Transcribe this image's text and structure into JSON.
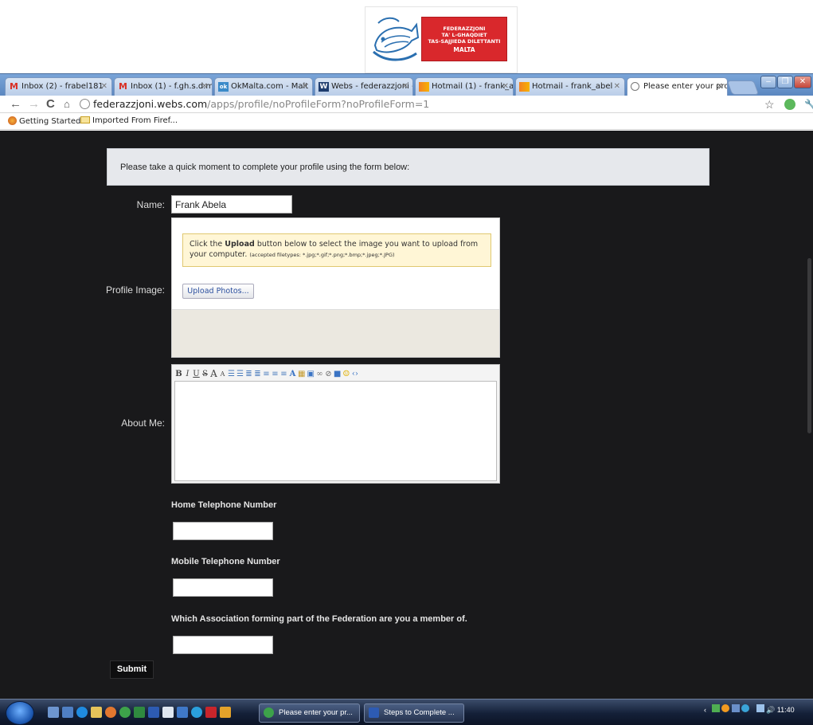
{
  "logo": {
    "lines": [
      "FEDERAZZJONI",
      "TA' L-GHAQDIET",
      "TAS-SAJJIEDA DILETTANTI",
      "MALTA"
    ]
  },
  "browser": {
    "tabs": [
      {
        "label": "Inbox (2) - frabel181",
        "icon": "gmail-icon"
      },
      {
        "label": "Inbox (1) - f.gh.s.d.m",
        "icon": "gmail-icon"
      },
      {
        "label": "OkMalta.com - Malt",
        "icon": "okmalta-icon"
      },
      {
        "label": "Webs - federazzjoni -",
        "icon": "webs-icon"
      },
      {
        "label": "Hotmail (1) - frank_al",
        "icon": "hotmail-icon"
      },
      {
        "label": "Hotmail - frank_abel",
        "icon": "hotmail-icon"
      },
      {
        "label": "Please enter your pro",
        "icon": "page-icon"
      }
    ],
    "url_host": "federazzjoni.webs.com",
    "url_path": "/apps/profile/noProfileForm?noProfileForm=1",
    "bookmarks": [
      "Getting Started",
      "Imported From Firef..."
    ]
  },
  "form": {
    "notice": "Please take a quick moment to complete your profile using the form below:",
    "name_label": "Name:",
    "name_value": "Frank Abela",
    "profile_image_label": "Profile Image:",
    "upload_tip_pre": "Click the ",
    "upload_tip_bold": "Upload",
    "upload_tip_post": " button below to select the image you want to upload from your computer.",
    "upload_tip_small": "(accepted filetypes: *.jpg;*.gif;*.png;*.bmp;*.jpeg;*.JPG)",
    "upload_button": "Upload Photos...",
    "about_label": "About Me:",
    "home_phone_label": "Home Telephone Number",
    "home_phone_value": "",
    "mobile_phone_label": "Mobile Telephone Number",
    "mobile_phone_value": "",
    "association_label": "Which Association forming part of the Federation are you a member of.",
    "association_value": "",
    "submit": "Submit"
  },
  "taskbar": {
    "items": [
      "Please enter your pr...",
      "Steps to Complete ..."
    ],
    "clock": "11:40"
  }
}
